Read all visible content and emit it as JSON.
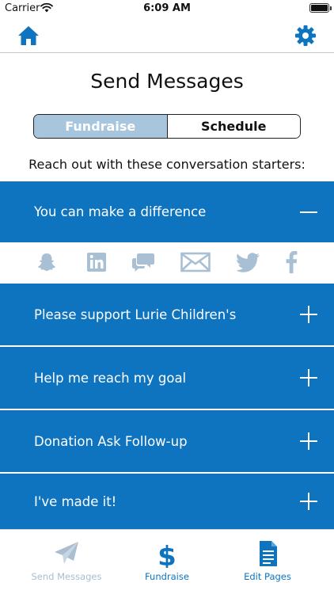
{
  "status_bar": {
    "carrier": "Carrier",
    "time": "6:09 AM"
  },
  "nav": {
    "home_icon": "home-icon",
    "settings_icon": "gear-icon"
  },
  "page": {
    "title": "Send Messages",
    "segments": [
      "Fundraise",
      "Schedule"
    ],
    "selected_segment": "Fundraise",
    "subtitle": "Reach out with these conversation starters:"
  },
  "messages": {
    "open_item": {
      "label": "You can make a difference",
      "toggle": "minus-icon"
    },
    "share_icons": [
      "snapchat-icon",
      "linkedin-icon",
      "chat-icon",
      "email-icon",
      "twitter-icon",
      "facebook-icon"
    ],
    "items": [
      {
        "label": "Please support Lurie Children's",
        "toggle": "plus-icon"
      },
      {
        "label": "Help me reach my goal",
        "toggle": "plus-icon"
      },
      {
        "label": "Donation Ask Follow-up",
        "toggle": "plus-icon"
      },
      {
        "label": "I've made it!",
        "toggle": "plus-icon"
      }
    ]
  },
  "tab_bar": {
    "tabs": [
      {
        "label": "Send Messages",
        "icon": "paper-plane-icon",
        "state": "inactive"
      },
      {
        "label": "Fundraise",
        "icon": "dollar-icon",
        "state": "active"
      },
      {
        "label": "Edit Pages",
        "icon": "document-icon",
        "state": "inactive"
      }
    ]
  },
  "colors": {
    "primary": "#0f74bf",
    "segment_selected": "#a7c6de",
    "share_icon": "#a9c0d4",
    "tab_muted": "#a9bed0"
  }
}
